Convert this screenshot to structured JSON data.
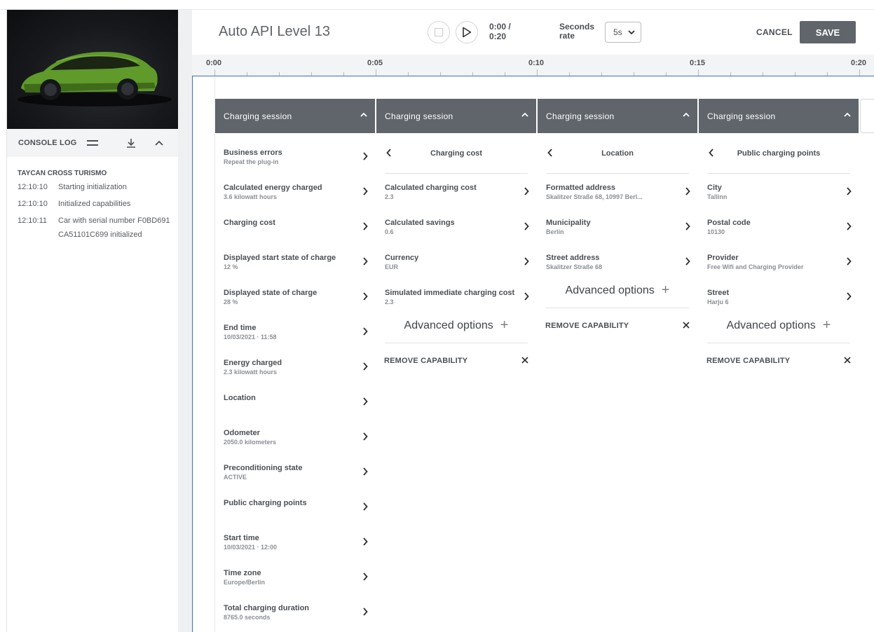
{
  "app": {
    "title": "Auto API Level 13"
  },
  "player": {
    "time_current": "0:00 /",
    "time_total": "0:20",
    "rate_label": "Seconds rate",
    "rate_value": "5s",
    "cancel_label": "CANCEL",
    "save_label": "SAVE"
  },
  "sidebar": {
    "console_title": "CONSOLE LOG",
    "vehicle": "TAYCAN CROSS TURISMO",
    "logs": [
      {
        "time": "12:10:10",
        "msg": "Starting initialization"
      },
      {
        "time": "12:10:10",
        "msg": "Initialized capabilities"
      },
      {
        "time": "12:10:11",
        "msg": "Car with serial number F0BD691CA51101C699 initialized"
      }
    ]
  },
  "timeline": {
    "ticks": [
      "0:00",
      "0:05",
      "0:10",
      "0:15",
      "0:20"
    ]
  },
  "cards": [
    {
      "title": "Charging session",
      "properties": [
        {
          "name": "Business errors",
          "value": "Repeat the plug-in"
        },
        {
          "name": "Calculated energy charged",
          "value": "3.6 kilowatt hours"
        },
        {
          "name": "Charging cost",
          "value": ""
        },
        {
          "name": "Displayed start state of charge",
          "value": "12 %"
        },
        {
          "name": "Displayed state of charge",
          "value": "28 %"
        },
        {
          "name": "End time",
          "value": "10/03/2021 · 11:58"
        },
        {
          "name": "Energy charged",
          "value": "2.3 kilowatt hours"
        },
        {
          "name": "Location",
          "value": ""
        },
        {
          "name": "Odometer",
          "value": "2050.0 kilometers"
        },
        {
          "name": "Preconditioning state",
          "value": "ACTIVE"
        },
        {
          "name": "Public charging points",
          "value": ""
        },
        {
          "name": "Start time",
          "value": "10/03/2021 · 12:00"
        },
        {
          "name": "Time zone",
          "value": "Europe/Berlin"
        },
        {
          "name": "Total charging duration",
          "value": "8765.0 seconds"
        }
      ]
    },
    {
      "title": "Charging session",
      "subtitle": "Charging cost",
      "properties": [
        {
          "name": "Calculated charging cost",
          "value": "2.3"
        },
        {
          "name": "Calculated savings",
          "value": "0.6"
        },
        {
          "name": "Currency",
          "value": "EUR"
        },
        {
          "name": "Simulated immediate charging cost",
          "value": "2.3"
        }
      ],
      "advanced_label": "Advanced options",
      "remove_label": "REMOVE CAPABILITY"
    },
    {
      "title": "Charging session",
      "subtitle": "Location",
      "properties": [
        {
          "name": "Formatted address",
          "value": "Skalitzer Straße 68, 10997 Berl..."
        },
        {
          "name": "Municipality",
          "value": "Berlin"
        },
        {
          "name": "Street address",
          "value": "Skalitzer Straße 68"
        }
      ],
      "advanced_label": "Advanced options",
      "remove_label": "REMOVE CAPABILITY"
    },
    {
      "title": "Charging session",
      "subtitle": "Public charging points",
      "properties": [
        {
          "name": "City",
          "value": "Tallinn"
        },
        {
          "name": "Postal code",
          "value": "10130"
        },
        {
          "name": "Provider",
          "value": "Free Wifi and Charging Provider"
        },
        {
          "name": "Street",
          "value": "Harju 6"
        }
      ],
      "advanced_label": "Advanced options",
      "remove_label": "REMOVE CAPABILITY"
    }
  ]
}
